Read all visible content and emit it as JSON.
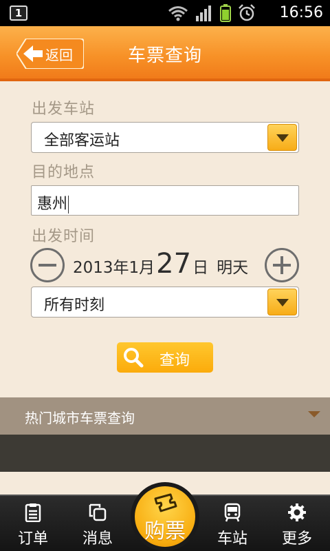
{
  "statusbar": {
    "notification_badge": "1",
    "time": "16:56"
  },
  "header": {
    "back_label": "返回",
    "title": "车票查询"
  },
  "form": {
    "departure_station_label": "出发车站",
    "departure_station_value": "全部客运站",
    "destination_label": "目的地点",
    "destination_value": "惠州",
    "departure_time_label": "出发时间",
    "date": {
      "year_month": "2013年1月",
      "day": "27",
      "day_suffix": "日",
      "relative": "明天"
    },
    "time_slot_value": "所有时刻",
    "query_label": "查询"
  },
  "hot_cities": {
    "label": "热门城市车票查询"
  },
  "bottom_nav": {
    "orders": "订单",
    "messages": "消息",
    "buy": "购票",
    "station": "车站",
    "more": "更多"
  },
  "colors": {
    "accent": "#f7931e",
    "button": "#fbb515",
    "background": "#f5eadb",
    "hot_bar": "#a19281"
  }
}
